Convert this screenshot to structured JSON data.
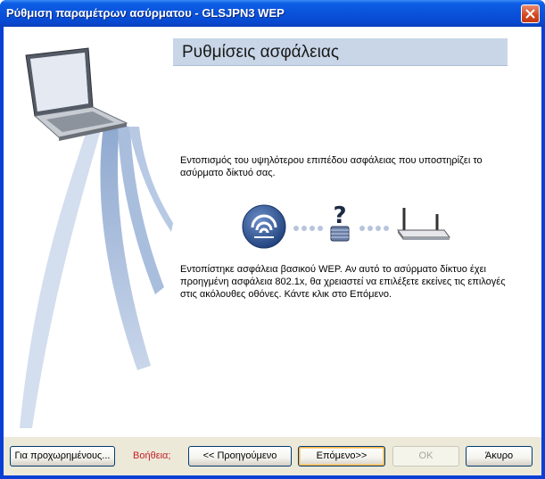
{
  "window": {
    "title": "Ρύθμιση παραμέτρων ασύρματου - GLSJPN3 WEP"
  },
  "header": {
    "title": "Ρυθμίσεις ασφάλειας"
  },
  "content": {
    "paragraph1": "Εντοπισμός του υψηλότερου επιπέδου ασφάλειας που υποστηρίζει το ασύρματο δίκτυό σας.",
    "paragraph2": "Εντοπίστηκε ασφάλεια βασικού WEP. Αν αυτό το ασύρματο δίκτυο έχει προηγμένη ασφάλεια 802.1x, θα χρειαστεί να επιλέξετε εκείνες τις επιλογές στις ακόλουθες οθόνες. Κάντε κλικ στο Επόμενο."
  },
  "footer": {
    "advanced_label": "Για προχωρημένους...",
    "help_label": "Βοήθεια;",
    "back_label": "<< Προηγούμενο",
    "next_label": "Επόμενο>>",
    "ok_label": "OK",
    "cancel_label": "Άκυρο"
  },
  "colors": {
    "titlebar": "#0a52da",
    "header_band": "#c8d6e8",
    "help_text": "#c3202a"
  },
  "icons": [
    "close-icon",
    "laptop-icon",
    "wireless-signal-icon",
    "padlock-question-icon",
    "router-icon"
  ]
}
